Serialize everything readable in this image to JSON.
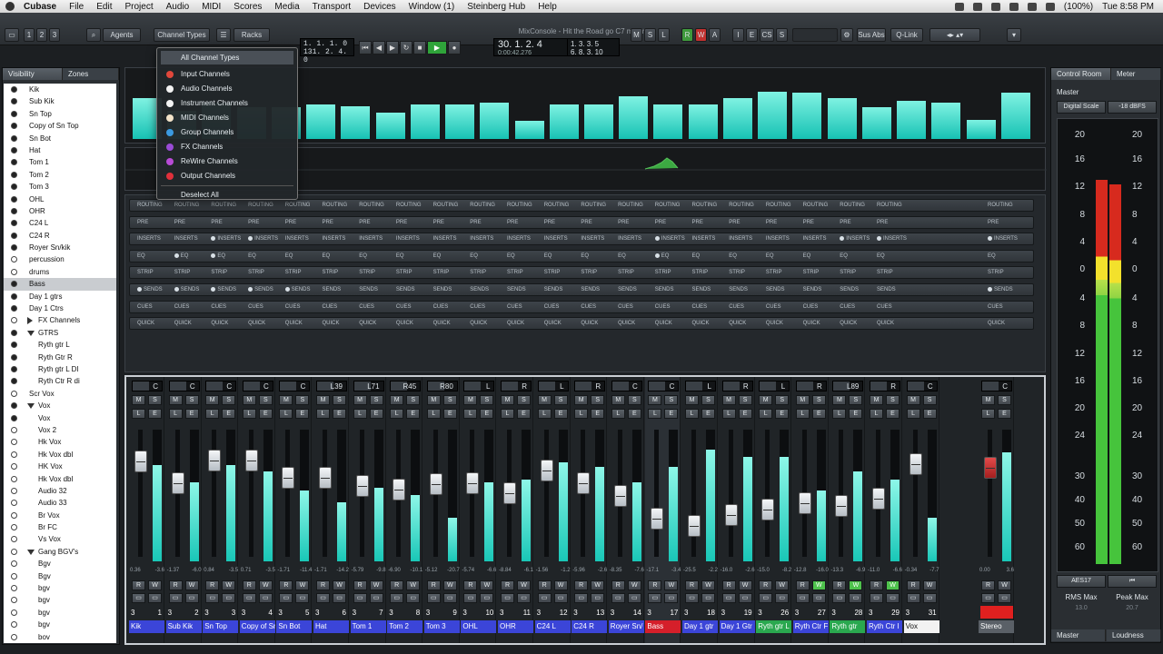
{
  "menubar": {
    "app": "Cubase",
    "menus": [
      "File",
      "Edit",
      "Project",
      "Audio",
      "MIDI",
      "Scores",
      "Media",
      "Transport",
      "Devices",
      "Window (1)",
      "Steinberg Hub",
      "Help"
    ],
    "battery": "(100%)",
    "clock": "Tue 8:58 PM"
  },
  "window": {
    "title": "MixConsole - Hit the Road go C7 mixer"
  },
  "toolbar": {
    "pages": [
      "1",
      "2",
      "3"
    ],
    "agents": "Agents",
    "channel_types": "Channel Types",
    "racks": "Racks",
    "pos_small_1": "1.  1.  1.   0",
    "pos_small_2": "131.  2.  4.   0",
    "position": "30.  1.  2.    4",
    "position_sub": "0:00:42.276",
    "bars_1": "1.  3.  3.  5",
    "bars_2": "6.  8.  3.  10",
    "btns": [
      "M",
      "S",
      "L",
      "R",
      "W",
      "A",
      "I",
      "E",
      "CS",
      "S"
    ],
    "sus_abs": "Sus Abs",
    "q_link": "Q-Link"
  },
  "left": {
    "tab_visibility": "Visibility",
    "tab_zones": "Zones",
    "items": [
      {
        "label": "Kik",
        "dot": "on",
        "ind": false
      },
      {
        "label": "Sub Kik",
        "dot": "on",
        "ind": false
      },
      {
        "label": "Sn Top",
        "dot": "on",
        "ind": false
      },
      {
        "label": "Copy of Sn Top",
        "dot": "on",
        "ind": false
      },
      {
        "label": "Sn Bot",
        "dot": "on",
        "ind": false
      },
      {
        "label": "Hat",
        "dot": "on",
        "ind": false
      },
      {
        "label": "Tom 1",
        "dot": "on",
        "ind": false
      },
      {
        "label": "Tom 2",
        "dot": "on",
        "ind": false
      },
      {
        "label": "Tom 3",
        "dot": "on",
        "ind": false
      },
      {
        "label": "OHL",
        "dot": "on",
        "ind": false
      },
      {
        "label": "OHR",
        "dot": "on",
        "ind": false
      },
      {
        "label": "C24 L",
        "dot": "on",
        "ind": false
      },
      {
        "label": "C24 R",
        "dot": "on",
        "ind": false
      },
      {
        "label": "Royer Sn/kik",
        "dot": "on",
        "ind": false
      },
      {
        "label": "percussion",
        "dot": "off",
        "ind": false
      },
      {
        "label": "drums",
        "dot": "off",
        "ind": false
      },
      {
        "label": "Bass",
        "dot": "on",
        "ind": false,
        "sel": true
      },
      {
        "label": "Day 1 gtrs",
        "dot": "on",
        "ind": false
      },
      {
        "label": "Day 1 Ctrs",
        "dot": "on",
        "ind": false
      },
      {
        "label": "FX Channels",
        "dot": "off",
        "ind": false,
        "tri": "r"
      },
      {
        "label": "GTRS",
        "dot": "on",
        "ind": false,
        "tri": "d"
      },
      {
        "label": "Ryth gtr L",
        "dot": "on",
        "ind": true
      },
      {
        "label": "Ryth Gtr R",
        "dot": "on",
        "ind": true
      },
      {
        "label": "Ryth gtr L DI",
        "dot": "on",
        "ind": true
      },
      {
        "label": "Ryth Ctr R di",
        "dot": "on",
        "ind": true
      },
      {
        "label": "Scr Vox",
        "dot": "off",
        "ind": false
      },
      {
        "label": "Vox",
        "dot": "on",
        "ind": false,
        "tri": "d"
      },
      {
        "label": "Vox",
        "dot": "on",
        "ind": true
      },
      {
        "label": "Vox 2",
        "dot": "off",
        "ind": true
      },
      {
        "label": "Hk Vox",
        "dot": "off",
        "ind": true
      },
      {
        "label": "Hk Vox dbl",
        "dot": "off",
        "ind": true
      },
      {
        "label": "HK Vox",
        "dot": "off",
        "ind": true
      },
      {
        "label": "Hk Vox dbl",
        "dot": "off",
        "ind": true
      },
      {
        "label": "Audio 32",
        "dot": "off",
        "ind": true
      },
      {
        "label": "Audio 33",
        "dot": "off",
        "ind": true
      },
      {
        "label": "Br Vox",
        "dot": "off",
        "ind": true
      },
      {
        "label": "Br FC",
        "dot": "off",
        "ind": true
      },
      {
        "label": "Vs Vox",
        "dot": "off",
        "ind": true
      },
      {
        "label": "Gang BGV's",
        "dot": "off",
        "ind": false,
        "tri": "d"
      },
      {
        "label": "Bgv",
        "dot": "off",
        "ind": true
      },
      {
        "label": "Bgv",
        "dot": "off",
        "ind": true
      },
      {
        "label": "bgv",
        "dot": "off",
        "ind": true
      },
      {
        "label": "bgv",
        "dot": "off",
        "ind": true
      },
      {
        "label": "bgv",
        "dot": "off",
        "ind": true
      },
      {
        "label": "bgv",
        "dot": "off",
        "ind": true
      },
      {
        "label": "bov",
        "dot": "off",
        "ind": true
      }
    ]
  },
  "dropdown": {
    "header": "All Channel Types",
    "items": [
      {
        "label": "Input Channels",
        "color": "#e0473b"
      },
      {
        "label": "Audio Channels",
        "color": "#f2f2f2"
      },
      {
        "label": "Instrument Channels",
        "color": "#f2f2f2"
      },
      {
        "label": "MIDI Channels",
        "color": "#f3e3c9"
      },
      {
        "label": "Group Channels",
        "color": "#3b9ae0"
      },
      {
        "label": "FX Channels",
        "color": "#9a4bd6"
      },
      {
        "label": "ReWire Channels",
        "color": "#b84bd6"
      },
      {
        "label": "Output Channels",
        "color": "#e0303b"
      }
    ],
    "deselect": "Deselect All"
  },
  "racks": {
    "rows": [
      "ROUTING",
      "PRE",
      "INSERTS",
      "EQ",
      "STRIP",
      "SENDS",
      "CUES",
      "QUICK"
    ]
  },
  "overview_levels": [
    0.7,
    0.48,
    0.62,
    0.55,
    0.55,
    0.6,
    0.57,
    0.45,
    0.6,
    0.6,
    0.63,
    0.32,
    0.6,
    0.6,
    0.73,
    0.6,
    0.6,
    0.7,
    0.82,
    0.8,
    0.7,
    0.55,
    0.66,
    0.62,
    0.33,
    0.8
  ],
  "channels": [
    {
      "name": "Kik",
      "num": "1",
      "pan": "C",
      "fader": 0.75,
      "level": 0.73,
      "vol": "0.36",
      "pk": "-3.6",
      "color": "#3b45d8",
      "w": false
    },
    {
      "name": "Sub Kik",
      "num": "2",
      "pan": "C",
      "fader": 0.58,
      "level": 0.6,
      "vol": "-1.37",
      "pk": "-6.0",
      "color": "#3b45d8",
      "w": false
    },
    {
      "name": "Sn Top",
      "num": "3",
      "pan": "C",
      "fader": 0.76,
      "level": 0.73,
      "vol": "0.84",
      "pk": "-3.5",
      "color": "#3b45d8",
      "w": false
    },
    {
      "name": "Copy of Sn",
      "num": "4",
      "pan": "C",
      "fader": 0.76,
      "level": 0.68,
      "vol": "0.71",
      "pk": "-3.5",
      "color": "#3b45d8",
      "w": false
    },
    {
      "name": "Sn Bot",
      "num": "5",
      "pan": "C",
      "fader": 0.62,
      "level": 0.54,
      "vol": "-1.71",
      "pk": "-11.4",
      "color": "#3b45d8",
      "w": false
    },
    {
      "name": "Hat",
      "num": "6",
      "pan": "L39",
      "fader": 0.62,
      "level": 0.45,
      "vol": "-1.71",
      "pk": "-14.2",
      "color": "#3b45d8",
      "w": false
    },
    {
      "name": "Tom 1",
      "num": "7",
      "pan": "L71",
      "fader": 0.56,
      "level": 0.56,
      "vol": "-5.79",
      "pk": "-9.8",
      "color": "#3b45d8",
      "w": false
    },
    {
      "name": "Tom 2",
      "num": "8",
      "pan": "R45",
      "fader": 0.53,
      "level": 0.5,
      "vol": "-6.90",
      "pk": "-10.1",
      "color": "#3b45d8",
      "w": false
    },
    {
      "name": "Tom 3",
      "num": "9",
      "pan": "R80",
      "fader": 0.57,
      "level": 0.33,
      "vol": "-5.12",
      "pk": "-20.7",
      "color": "#3b45d8",
      "w": false
    },
    {
      "name": "OHL",
      "num": "10",
      "pan": "L",
      "fader": 0.58,
      "level": 0.6,
      "vol": "-5.74",
      "pk": "-6.6",
      "color": "#3b45d8",
      "w": false
    },
    {
      "name": "OHR",
      "num": "11",
      "pan": "R",
      "fader": 0.5,
      "level": 0.62,
      "vol": "-8.84",
      "pk": "-6.1",
      "color": "#3b45d8",
      "w": false
    },
    {
      "name": "C24 L",
      "num": "12",
      "pan": "L",
      "fader": 0.68,
      "level": 0.75,
      "vol": "-1.56",
      "pk": "-1.2",
      "color": "#3b45d8",
      "w": false
    },
    {
      "name": "C24 R",
      "num": "13",
      "pan": "R",
      "fader": 0.58,
      "level": 0.72,
      "vol": "-5.96",
      "pk": "-2.6",
      "color": "#3b45d8",
      "w": false
    },
    {
      "name": "Royer Sn/",
      "num": "14",
      "pan": "C",
      "fader": 0.48,
      "level": 0.6,
      "vol": "-8.35",
      "pk": "-7.6",
      "color": "#3b45d8",
      "w": false
    },
    {
      "name": "Bass",
      "num": "17",
      "pan": "C",
      "fader": 0.3,
      "level": 0.72,
      "vol": "-17.1",
      "pk": "-3.4",
      "color": "#d51f2a",
      "w": false,
      "sel": true
    },
    {
      "name": "Day 1 gtr",
      "num": "18",
      "pan": "L",
      "fader": 0.24,
      "level": 0.85,
      "vol": "-25.5",
      "pk": "-2.2",
      "color": "#3b45d8",
      "w": false
    },
    {
      "name": "Day 1 Gtr",
      "num": "19",
      "pan": "R",
      "fader": 0.33,
      "level": 0.79,
      "vol": "-16.0",
      "pk": "-2.6",
      "color": "#3b45d8",
      "w": false
    },
    {
      "name": "Ryth gtr L",
      "num": "26",
      "pan": "L",
      "fader": 0.37,
      "level": 0.79,
      "vol": "-15.0",
      "pk": "-8.2",
      "color": "#2aa84f",
      "w": false
    },
    {
      "name": "Ryth Ctr F",
      "num": "27",
      "pan": "R",
      "fader": 0.42,
      "level": 0.54,
      "vol": "-12.8",
      "pk": "-16.0",
      "color": "#3b45d8",
      "w": true
    },
    {
      "name": "Ryth gtr",
      "num": "28",
      "pan": "L89",
      "fader": 0.4,
      "level": 0.68,
      "vol": "-13.3",
      "pk": "-6.9",
      "color": "#2aa84f",
      "w": true
    },
    {
      "name": "Ryth Ctr I",
      "num": "29",
      "pan": "R",
      "fader": 0.46,
      "level": 0.62,
      "vol": "-11.0",
      "pk": "-6.6",
      "color": "#3b45d8",
      "w": true
    },
    {
      "name": "Vox",
      "num": "31",
      "pan": "C",
      "fader": 0.73,
      "level": 0.33,
      "vol": "-0.34",
      "pk": "-7.7",
      "color": "#f2f2f2",
      "w": false
    }
  ],
  "stereo": {
    "name": "Stereo",
    "pan": "C",
    "vol": "0.00",
    "pk": "3.6"
  },
  "control_room": {
    "tab_control_room": "Control Room",
    "tab_meter": "Meter",
    "master_label": "Master",
    "digital_scale": "Digital Scale",
    "dbfs": "-18 dBFS",
    "scale": [
      "20",
      "16",
      "12",
      "8",
      "4",
      "0",
      "4",
      "8",
      "12",
      "16",
      "20",
      "24",
      "30",
      "40",
      "50",
      "60"
    ],
    "aes": "AES17",
    "rms_label": "RMS Max",
    "peak_label": "Peak Max",
    "rms": "13.0",
    "peak": "20.7",
    "tab_master": "Master",
    "tab_loudness": "Loudness",
    "rms_level": 0.9,
    "peak_level": 0.89
  }
}
